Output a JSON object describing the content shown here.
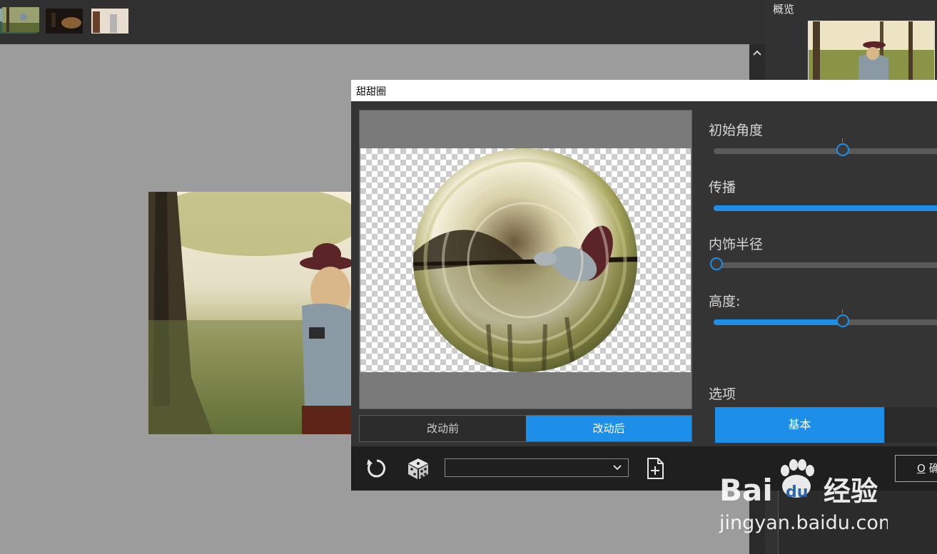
{
  "overview_panel": {
    "title": "概览"
  },
  "dialog": {
    "title": "甜甜圈",
    "tabs": [
      {
        "label": "改动前",
        "active": false
      },
      {
        "label": "改动后",
        "active": true
      }
    ],
    "controls": [
      {
        "label": "初始角度",
        "value_fraction": 0.57
      },
      {
        "label": "传播",
        "value_fraction": 1.0
      },
      {
        "label": "内饰半径",
        "value_fraction": 0.0
      },
      {
        "label": "高度:",
        "value_fraction": 0.57
      }
    ],
    "options": {
      "label": "选项",
      "buttons": [
        {
          "label": "基本",
          "active": true
        },
        {
          "label": "",
          "active": false
        }
      ]
    },
    "footer": {
      "preset_value": "",
      "ok_mnemonic": "O",
      "ok_label": "确"
    }
  },
  "watermark": {
    "brand": "Bai du 经验",
    "url": "jingyan.baidu.com"
  },
  "colors": {
    "accent": "#1e8fe8",
    "panel": "#343434",
    "toolbar": "#303030",
    "canvas": "#9c9c9c"
  }
}
